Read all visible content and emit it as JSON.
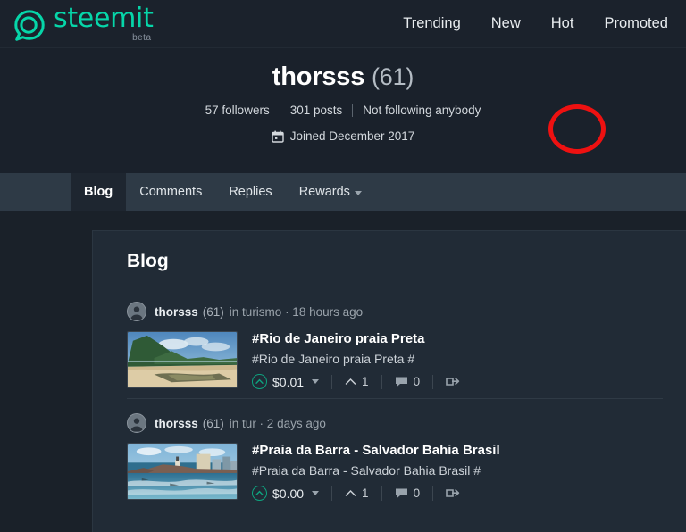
{
  "header": {
    "brand_name": "steemit",
    "brand_sub": "beta",
    "logo_icon": "steemit-logo-icon",
    "nav": [
      {
        "label": "Trending"
      },
      {
        "label": "New"
      },
      {
        "label": "Hot"
      },
      {
        "label": "Promoted"
      }
    ]
  },
  "profile": {
    "username": "thorsss",
    "reputation": "(61)",
    "followers": "57 followers",
    "posts": "301 posts",
    "following": "Not following anybody",
    "joined": "Joined December 2017",
    "calendar_icon": "calendar-icon",
    "annotation_color": "#ee1111"
  },
  "tabs": [
    {
      "label": "Blog",
      "active": true
    },
    {
      "label": "Comments",
      "active": false
    },
    {
      "label": "Replies",
      "active": false
    },
    {
      "label": "Rewards",
      "active": false,
      "has_caret": true
    }
  ],
  "main": {
    "section_title": "Blog",
    "posts": [
      {
        "author": "thorsss",
        "reputation": "(61)",
        "meta": "in turismo · 18 hours ago",
        "title": "#Rio de Janeiro praia Preta",
        "summary": "#Rio de Janeiro praia Preta #",
        "payout": "$0.01",
        "votes": "1",
        "comments": "0",
        "thumbnail_alt": "beach-with-green-hillside-thumbnail",
        "avatar_icon": "user-avatar-icon",
        "upvote_icon": "upvote-icon",
        "vote_icon": "chevron-up-icon",
        "comment_icon": "comment-icon",
        "reshare_icon": "reshare-icon"
      },
      {
        "author": "thorsss",
        "reputation": "(61)",
        "meta": "in tur · 2 days ago",
        "title": "#Praia da Barra - Salvador Bahia Brasil",
        "summary": "#Praia da Barra - Salvador Bahia Brasil #",
        "payout": "$0.00",
        "votes": "1",
        "comments": "0",
        "thumbnail_alt": "coastal-city-lighthouse-thumbnail",
        "avatar_icon": "user-avatar-icon",
        "upvote_icon": "upvote-icon",
        "vote_icon": "chevron-up-icon",
        "comment_icon": "comment-icon",
        "reshare_icon": "reshare-icon"
      }
    ]
  },
  "colors": {
    "brand": "#06d6a9",
    "page_bg": "#1a2129",
    "card_bg": "#212b36",
    "tabbar_bg": "#2e3a46",
    "annotation": "#ee1111"
  }
}
